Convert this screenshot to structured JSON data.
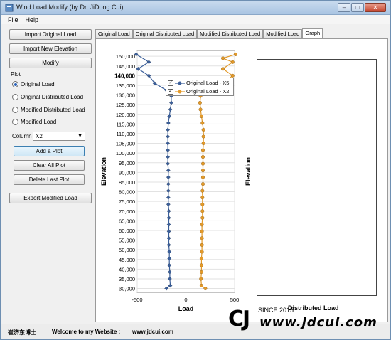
{
  "window": {
    "title": "Wind Load Modify (by Dr. JiDong Cui)",
    "controls": [
      "–",
      "□",
      "✕"
    ]
  },
  "menu": {
    "items": [
      "File",
      "Help"
    ]
  },
  "left_panel": {
    "buttons": {
      "import_original": "Import Original Load",
      "import_elevation": "Import New Elevation",
      "modify": "Modify",
      "export": "Export Modified Load"
    },
    "plot_label": "Plot",
    "radios": [
      {
        "label": "Original Load",
        "selected": true
      },
      {
        "label": "Original Distributed Load",
        "selected": false
      },
      {
        "label": "Modified Distributed Load",
        "selected": false
      },
      {
        "label": "Modified Load",
        "selected": false
      }
    ],
    "column_label": "Column",
    "column_value": "X2",
    "plot_buttons": {
      "add": "Add a Plot",
      "clear": "Clear All Plot",
      "delete": "Delete Last Plot"
    }
  },
  "tabs": [
    {
      "label": "Original Load",
      "active": false
    },
    {
      "label": "Original Distributed Load",
      "active": false
    },
    {
      "label": "Modified Distributed Load",
      "active": false
    },
    {
      "label": "Modified Load",
      "active": false
    },
    {
      "label": "Graph",
      "active": true
    }
  ],
  "status": {
    "name": "崔济东博士",
    "welcome": "Welcome to my Website :",
    "url": "www.jdcui.com"
  },
  "brand": {
    "logo": "CJ",
    "since": "SINCE 2015",
    "url": "www.jdcui.com"
  },
  "colors": {
    "series1": "#3b5f9a",
    "series2": "#e39a2a"
  },
  "chart_data": [
    {
      "type": "line",
      "title": "",
      "xlabel": "Load",
      "ylabel": "Elevation",
      "xlim": [
        -500,
        500
      ],
      "ylim": [
        28000,
        153000
      ],
      "x_ticks": [
        "-500",
        "0",
        "500"
      ],
      "y_ticks": [
        "150,000",
        "145,000",
        "140,000",
        "135,000",
        "130,000",
        "125,000",
        "120,000",
        "115,000",
        "110,000",
        "105,000",
        "100,000",
        "95,000",
        "90,000",
        "85,000",
        "80,000",
        "75,000",
        "70,000",
        "65,000",
        "60,000",
        "55,000",
        "50,000",
        "45,000",
        "40,000",
        "35,000",
        "30,000"
      ],
      "legend": "top-right",
      "series": [
        {
          "name": "Original Load - X5",
          "points": [
            [
              -200,
              30000
            ],
            [
              -160,
              31500
            ],
            [
              -165,
              35000
            ],
            [
              -165,
              38500
            ],
            [
              -170,
              42000
            ],
            [
              -170,
              45500
            ],
            [
              -170,
              49000
            ],
            [
              -175,
              52500
            ],
            [
              -175,
              56000
            ],
            [
              -175,
              59500
            ],
            [
              -175,
              63000
            ],
            [
              -175,
              66500
            ],
            [
              -175,
              70000
            ],
            [
              -180,
              73500
            ],
            [
              -180,
              77000
            ],
            [
              -180,
              80500
            ],
            [
              -180,
              84000
            ],
            [
              -180,
              87500
            ],
            [
              -180,
              91000
            ],
            [
              -185,
              94500
            ],
            [
              -185,
              98000
            ],
            [
              -185,
              101500
            ],
            [
              -185,
              105000
            ],
            [
              -185,
              108500
            ],
            [
              -185,
              112000
            ],
            [
              -180,
              115500
            ],
            [
              -170,
              119000
            ],
            [
              -160,
              122500
            ],
            [
              -150,
              126000
            ],
            [
              -150,
              129500
            ],
            [
              -200,
              132500
            ],
            [
              -320,
              136000
            ],
            [
              -380,
              140000
            ],
            [
              -490,
              143500
            ],
            [
              -380,
              147000
            ],
            [
              -510,
              151000
            ]
          ]
        },
        {
          "name": "Original Load - X2",
          "points": [
            [
              200,
              30000
            ],
            [
              160,
              31500
            ],
            [
              155,
              35000
            ],
            [
              160,
              38500
            ],
            [
              160,
              42000
            ],
            [
              160,
              45500
            ],
            [
              165,
              49000
            ],
            [
              165,
              52500
            ],
            [
              165,
              56000
            ],
            [
              165,
              59500
            ],
            [
              165,
              63000
            ],
            [
              170,
              66500
            ],
            [
              170,
              70000
            ],
            [
              170,
              73500
            ],
            [
              170,
              77000
            ],
            [
              170,
              80500
            ],
            [
              175,
              84000
            ],
            [
              175,
              87500
            ],
            [
              175,
              91000
            ],
            [
              175,
              94500
            ],
            [
              175,
              98000
            ],
            [
              175,
              101500
            ],
            [
              180,
              105000
            ],
            [
              180,
              108500
            ],
            [
              180,
              112000
            ],
            [
              170,
              115500
            ],
            [
              160,
              119000
            ],
            [
              150,
              122500
            ],
            [
              145,
              126000
            ],
            [
              150,
              129500
            ],
            [
              230,
              132500
            ],
            [
              380,
              136000
            ],
            [
              480,
              140000
            ],
            [
              380,
              143500
            ],
            [
              480,
              147000
            ],
            [
              380,
              149000
            ],
            [
              510,
              151000
            ]
          ]
        }
      ]
    },
    {
      "type": "line",
      "title": "",
      "xlabel": "Distributed Load",
      "ylabel": "Elevation",
      "series": []
    }
  ]
}
